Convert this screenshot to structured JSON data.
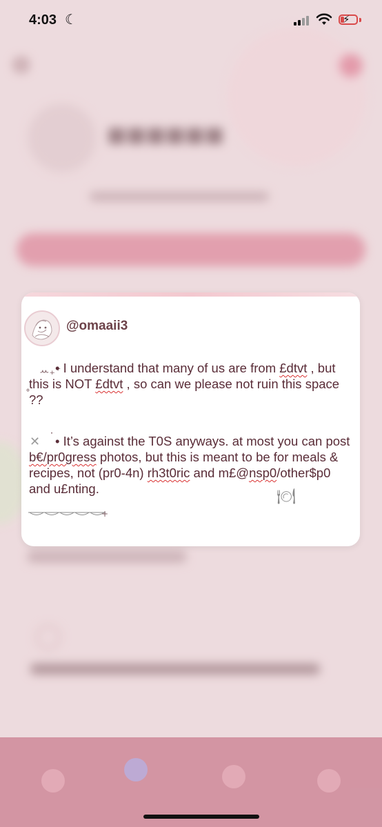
{
  "status_bar": {
    "time": "4:03",
    "moon_icon": "moon-icon",
    "signal_icon": "signal-icon",
    "wifi_icon": "wifi-icon",
    "battery_icon": "battery-charging-icon"
  },
  "post": {
    "handle": "@omaaii3",
    "para1_pre": "• I understand that many of us are from ",
    "para1_w1": "£dtvt",
    "para1_mid": " , but this is NOT ",
    "para1_w2": "£dtvt",
    "para1_post": " ,  so can we please not ruin this space ??",
    "para2_a": "• It’s against the T0S anyways. at most you can post ",
    "para2_w1": "b€/pr0gress",
    "para2_b": " photos, but this is meant to be for meals & recipes, not (pr0-4n) ",
    "para2_w2": "rh3t0ric",
    "para2_c": " and m£@",
    "para2_w3": "nsp0",
    "para2_d": "/other$p0 and u£nting.",
    "deco_top": "ꕀ₊⁺",
    "deco_hook": "˳",
    "deco_x": "✕",
    "deco_dot": "˙",
    "deco_cutlery": "🍽",
    "deco_plus": "+"
  },
  "colors": {
    "accent": "#c06b7f",
    "text": "#5a2d38",
    "handle": "#6d434a"
  }
}
